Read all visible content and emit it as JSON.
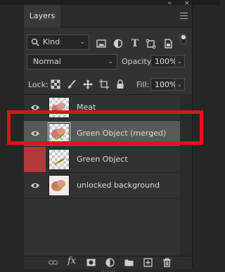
{
  "panel": {
    "tab_label": "Layers",
    "collapse_glyph": "‹‹",
    "close_glyph": "×",
    "menu_icon": "hamburger-menu-icon"
  },
  "filter": {
    "kind_label": "Kind",
    "kind_icon": "search-icon",
    "filter_icons": [
      "image-filter-icon",
      "adjustment-filter-icon",
      "type-filter-icon",
      "shape-filter-icon",
      "smart-object-filter-icon"
    ],
    "type_glyph": "T"
  },
  "blend": {
    "mode": "Normal",
    "opacity_label": "Opacity:",
    "opacity_value": "100%"
  },
  "lock": {
    "lock_label": "Lock:",
    "fill_label": "Fill:",
    "fill_value": "100%"
  },
  "layers": [
    {
      "name": "Meat",
      "selected": false,
      "eye_highlight": false
    },
    {
      "name": "Green Object (merged)",
      "selected": true,
      "eye_highlight": false
    },
    {
      "name": "Green Object",
      "selected": false,
      "eye_highlight": true
    },
    {
      "name": "unlocked background",
      "selected": false,
      "eye_highlight": false
    }
  ],
  "footer": {
    "fx_label": "fx",
    "icons": [
      "link-layers-icon",
      "fx-icon",
      "add-mask-icon",
      "adjustment-layer-icon",
      "new-group-icon",
      "new-layer-icon",
      "delete-layer-icon"
    ]
  },
  "colors": {
    "highlight": "#e4121a",
    "selected_row": "#595959",
    "eye_highlight": "#b23a3a"
  }
}
